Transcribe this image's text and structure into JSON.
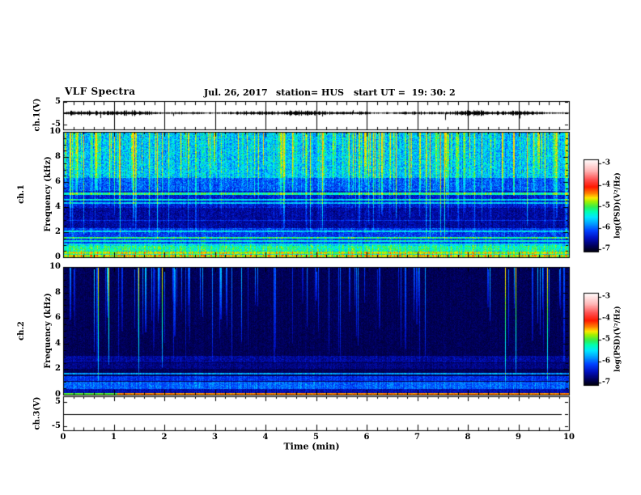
{
  "header": {
    "title": "VLF Spectra",
    "date": "Jul. 26, 2017",
    "station": "station= HUS",
    "start_ut": "start UT =  19: 30: 2"
  },
  "time_axis": {
    "label": "Time (min)",
    "tick_labels": [
      "0",
      "1",
      "2",
      "3",
      "4",
      "5",
      "6",
      "7",
      "8",
      "9",
      "10"
    ],
    "minor_step_min": 0.2
  },
  "freq_axis": {
    "tick_labels": [
      "10",
      "8",
      "6",
      "4",
      "2",
      "0"
    ],
    "minor_step_khz": 0.5
  },
  "volt_axis": {
    "tick_labels": [
      "5",
      "-5"
    ]
  },
  "panels": {
    "ch1_wave": {
      "ylabel": "ch.1(V)"
    },
    "ch1_spec": {
      "ylabel_line1": "ch.1",
      "ylabel_line2": "Frequency (kHz)"
    },
    "ch2_spec": {
      "ylabel_line1": "ch.2",
      "ylabel_line2": "Frequency (kHz)"
    },
    "ch3_wave": {
      "ylabel": "ch.3(V)"
    }
  },
  "colorbar": {
    "label": "log(PSD)(V²/Hz)",
    "tick_labels": [
      "-3",
      "-4",
      "-5",
      "-6",
      "-7"
    ],
    "gradient": [
      [
        0.0,
        "#000018"
      ],
      [
        0.06,
        "#000060"
      ],
      [
        0.14,
        "#0010c0"
      ],
      [
        0.22,
        "#0040ff"
      ],
      [
        0.3,
        "#00a0ff"
      ],
      [
        0.37,
        "#00e8ff"
      ],
      [
        0.43,
        "#00ffb0"
      ],
      [
        0.48,
        "#30ee50"
      ],
      [
        0.54,
        "#a0f000"
      ],
      [
        0.58,
        "#ffe800"
      ],
      [
        0.63,
        "#ff8000"
      ],
      [
        0.7,
        "#ff1800"
      ],
      [
        0.78,
        "#ff5050"
      ],
      [
        0.88,
        "#ffb8b8"
      ],
      [
        1.0,
        "#ffffff"
      ]
    ]
  },
  "chart_data": [
    {
      "type": "line",
      "name": "ch1-voltage-waveform",
      "ylabel": "ch.1(V)",
      "yrange_volts": [
        -5,
        5
      ],
      "xrange_min": [
        0,
        10
      ],
      "baseline_volts": 0,
      "noise_amp_volts": 0.5,
      "seed": 424242,
      "spikes": [
        {
          "t_min": 0.73,
          "volts": -2.2
        },
        {
          "t_min": 2.17,
          "volts": -1.3
        },
        {
          "t_min": 5.12,
          "volts": -1.5
        },
        {
          "t_min": 5.73,
          "volts": 1.3
        },
        {
          "t_min": 7.55,
          "volts": -3.1
        },
        {
          "t_min": 9.03,
          "volts": -2.4
        }
      ]
    },
    {
      "type": "heatmap",
      "name": "ch1-spectrogram",
      "xrange_min": [
        0,
        10
      ],
      "yrange_khz": [
        0,
        10
      ],
      "zlabel": "log(PSD)(V²/Hz)",
      "zrange": [
        -7,
        -3
      ],
      "seed": 12345,
      "background": {
        "base": 0.24,
        "noise": 0.2
      },
      "bands": [
        {
          "f0": 6.4,
          "f1": 10.0,
          "base": 0.24,
          "noise": 0.2
        },
        {
          "f0": 5.35,
          "f1": 6.4,
          "base": 0.16,
          "noise": 0.16
        },
        {
          "f0": 3.95,
          "f1": 5.35,
          "base": 0.1,
          "noise": 0.12
        },
        {
          "f0": 2.35,
          "f1": 3.95,
          "base": 0.065,
          "noise": 0.1
        },
        {
          "f0": 0.95,
          "f1": 2.35,
          "base": 0.14,
          "noise": 0.14
        },
        {
          "f0": 0.0,
          "f1": 0.95,
          "base": 0.28,
          "noise": 0.22
        }
      ],
      "lines": [
        {
          "f": 5.1,
          "hw": 0.08,
          "base": 0.38,
          "noise": 0.12
        },
        {
          "f": 4.62,
          "hw": 0.06,
          "base": 0.32,
          "noise": 0.1
        },
        {
          "f": 4.35,
          "hw": 0.05,
          "base": 0.29,
          "noise": 0.1
        },
        {
          "f": 2.95,
          "hw": 0.04,
          "base": 0.16,
          "noise": 0.08
        },
        {
          "f": 2.05,
          "hw": 0.06,
          "base": 0.31,
          "noise": 0.1
        },
        {
          "f": 1.55,
          "hw": 0.07,
          "base": 0.4,
          "noise": 0.12
        },
        {
          "f": 1.28,
          "hw": 0.05,
          "base": 0.35,
          "noise": 0.1
        },
        {
          "f": 1.03,
          "hw": 0.05,
          "base": 0.32,
          "noise": 0.1
        },
        {
          "f": 0.7,
          "hw": 0.2,
          "base": 0.36,
          "noise": 0.16
        },
        {
          "f": 0.33,
          "hw": 0.07,
          "base": 0.5,
          "noise": 0.1
        },
        {
          "f": 0.12,
          "hw": 0.06,
          "base": 0.55,
          "noise": 0.08
        },
        {
          "f": 0.02,
          "hw": 0.05,
          "base": 0.52,
          "noise": 0.05
        }
      ],
      "streaks": {
        "count": 160,
        "amp": [
          0.06,
          0.34
        ],
        "fmin_khz": [
          1.5,
          7.0
        ],
        "bright_count": 10,
        "bright_amp": 0.45,
        "bright_fmin_khz": 1.2
      }
    },
    {
      "type": "heatmap",
      "name": "ch2-spectrogram",
      "xrange_min": [
        0,
        10
      ],
      "yrange_khz": [
        0,
        10
      ],
      "zlabel": "log(PSD)(V²/Hz)",
      "zrange": [
        -7,
        -3
      ],
      "seed": 77777,
      "background": {
        "base": 0.03,
        "noise": 0.05
      },
      "bands": [
        {
          "f0": 2.55,
          "f1": 3.05,
          "base": 0.065,
          "noise": 0.09
        },
        {
          "f0": 2.0,
          "f1": 2.5,
          "base": 0.055,
          "noise": 0.07
        },
        {
          "f0": 1.05,
          "f1": 1.42,
          "base": 0.15,
          "noise": 0.1
        },
        {
          "f0": 0.42,
          "f1": 1.0,
          "base": 0.19,
          "noise": 0.12
        },
        {
          "f0": 0.1,
          "f1": 0.42,
          "base": 0.09,
          "noise": 0.08
        }
      ],
      "lines": [
        {
          "f": 1.62,
          "hw": 0.07,
          "base": 0.26,
          "noise": 0.09
        }
      ],
      "bottom_line": {
        "f_khz": 0.07,
        "split_t_min": 1.05,
        "left_level": 0.5,
        "right_level": 0.63
      },
      "streaks": {
        "count": 90,
        "amp": [
          0.1,
          0.3
        ],
        "fmin_khz": [
          2.5,
          7.5
        ],
        "bright_count": 7,
        "bright_amp": 0.55,
        "bright_fmin_khz": 1.0
      }
    },
    {
      "type": "line",
      "name": "ch3-voltage-waveform",
      "ylabel": "ch.3(V)",
      "yrange_volts": [
        -5,
        5
      ],
      "xrange_min": [
        0,
        10
      ],
      "constant_volts": 0,
      "t_end_min": 9.84
    }
  ]
}
